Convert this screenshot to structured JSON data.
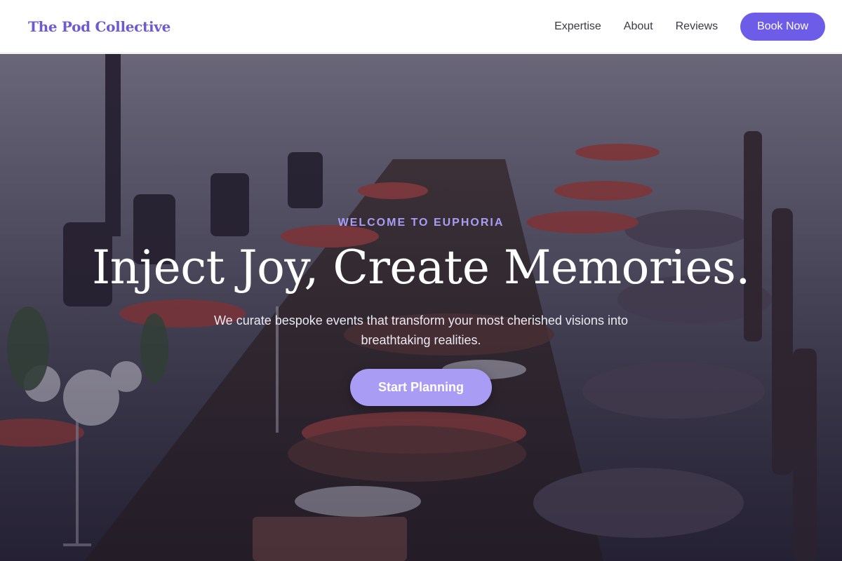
{
  "header": {
    "logo": "The Pod Collective",
    "nav": [
      {
        "label": "Expertise"
      },
      {
        "label": "About"
      },
      {
        "label": "Reviews"
      }
    ],
    "cta_label": "Book Now"
  },
  "hero": {
    "eyebrow": "WELCOME TO EUPHORIA",
    "headline": "Inject Joy, Create Memories.",
    "subtitle": "We curate bespoke events that transform your most cherished visions into breathtaking realities.",
    "cta_label": "Start Planning",
    "background": "long outdoor dining table with red napkins, wine glasses and wooden chairs on a beach"
  },
  "colors": {
    "brand": "#6c5ce7",
    "accent_light": "#a99cf5",
    "logo": "#6c5ccf"
  }
}
